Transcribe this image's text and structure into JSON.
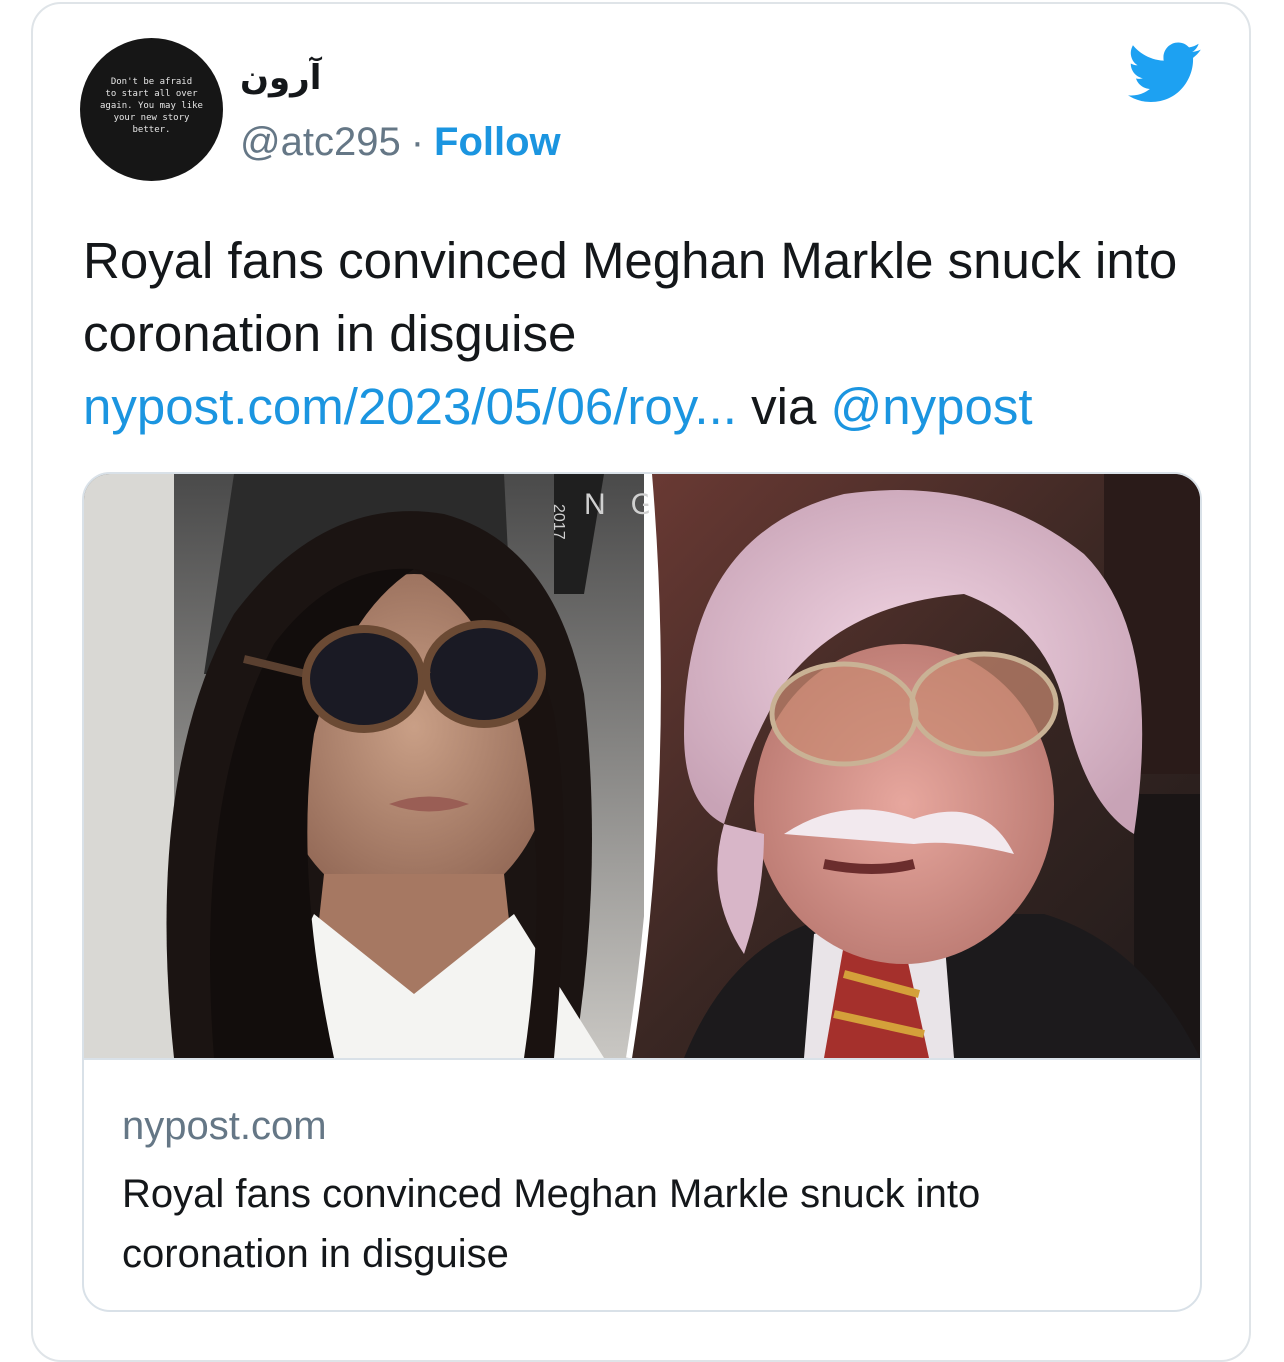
{
  "author": {
    "display_name": "آرون",
    "handle": "@atc295",
    "separator": "·",
    "follow_label": "Follow",
    "avatar_text": [
      "Don't be afraid",
      "to start all over",
      "again. You may like",
      "your new story",
      "better."
    ]
  },
  "tweet": {
    "text_line": "Royal fans convinced Meghan Markle snuck into coronation in disguise",
    "link_text": "nypost.com/2023/05/06/roy...",
    "via_label": "via",
    "mention": "@nypost"
  },
  "link_card": {
    "image_overlay_text": "N   G",
    "lanyard_text": "2017",
    "domain": "nypost.com",
    "title": "Royal fans convinced Meghan Markle snuck into coronation in disguise"
  },
  "colors": {
    "link_blue": "#1b95e0",
    "text_dark": "#14171a",
    "text_muted": "#657786",
    "border": "#dfe4e8"
  },
  "icons": {
    "brand": "twitter-bird-icon"
  }
}
